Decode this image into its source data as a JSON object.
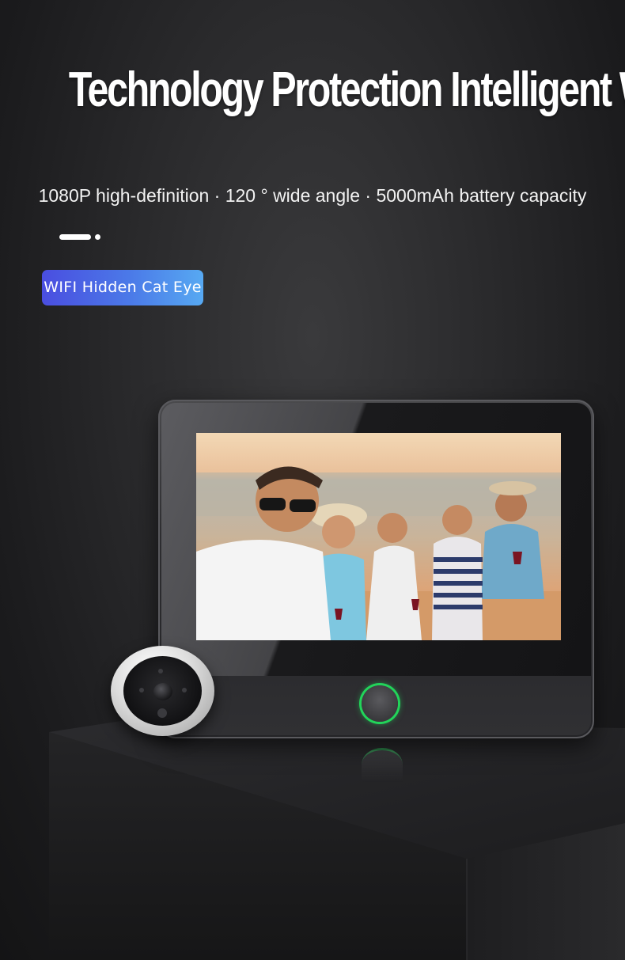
{
  "header": {
    "title": "Technology Protection Intelligent Watcher",
    "features": "1080P high-definition · 120 ° wide angle · 5000mAh battery capacity"
  },
  "carousel": {
    "active_index": 0,
    "count": 2
  },
  "product_tag": {
    "label": "WIFI Hidden Cat Eye"
  },
  "device": {
    "screen_content": "group-selfie-photo",
    "button_icon": "home-ring-icon",
    "camera_icon": "peephole-camera-icon",
    "accent_color": "#22d45a"
  },
  "colors": {
    "tag_gradient_start": "#4a4ee0",
    "tag_gradient_end": "#57a9f2",
    "background": "#2a2a2c"
  }
}
